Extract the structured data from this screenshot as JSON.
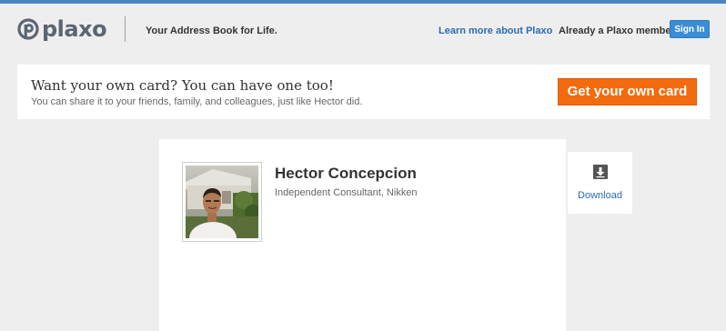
{
  "header": {
    "logo_text": "plaxo",
    "tagline": "Your Address Book for Life.",
    "learn_more": "Learn more about Plaxo",
    "member_prompt": "Already a Plaxo member?",
    "sign_in_label": "Sign In"
  },
  "promo": {
    "headline": "Want your own card? You can have one too!",
    "subtext": "You can share it to your friends, family, and colleagues, just like Hector did.",
    "cta_label": "Get your own card"
  },
  "contact": {
    "name": "Hector Concepcion",
    "title": "Independent Consultant, Nikken"
  },
  "download": {
    "label": "Download"
  },
  "colors": {
    "accent": "#4a86c5",
    "sign_in": "#3a8ed6",
    "cta": "#f26b0f",
    "link": "#2a6bb5"
  },
  "icons": {
    "logo": "plaxo-logo-icon",
    "download": "download-arrow-icon",
    "photo": "contact-photo"
  }
}
